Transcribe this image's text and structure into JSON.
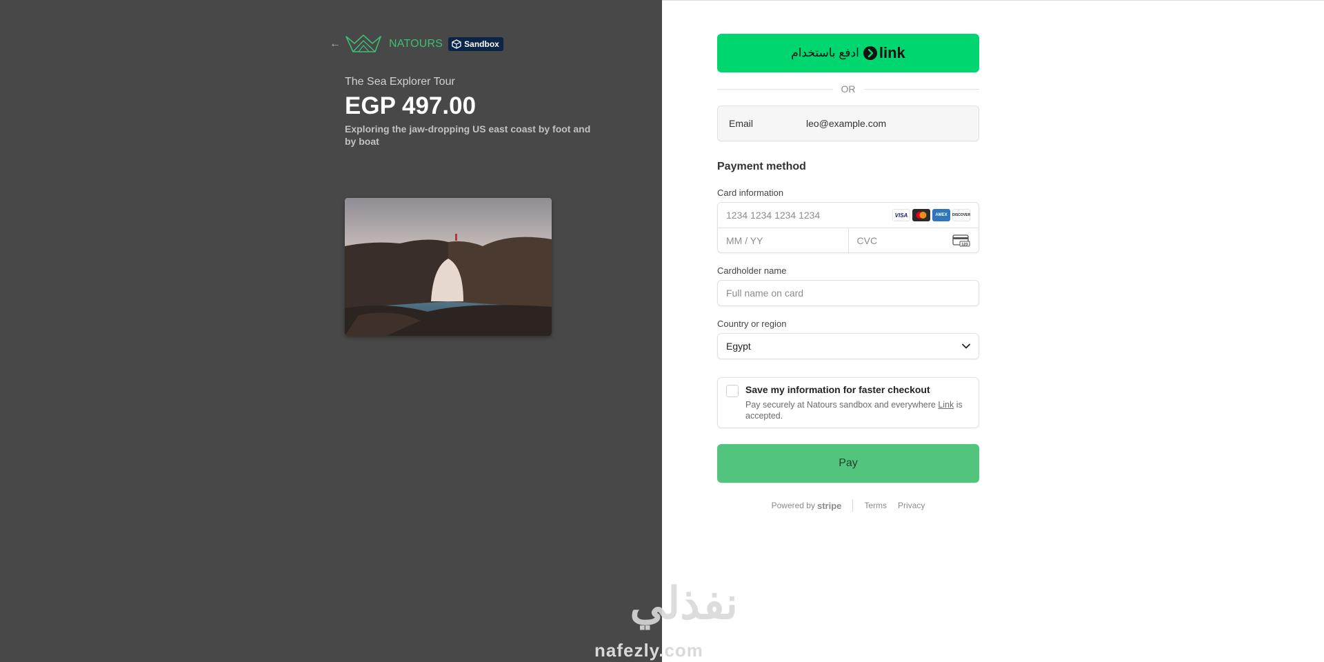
{
  "left": {
    "back_arrow": "←",
    "brand": "NATOURS",
    "sandbox_badge": "Sandbox",
    "tour_name": "The Sea Explorer Tour",
    "price": "EGP 497.00",
    "description": "Exploring the jaw-dropping US east coast by foot and by boat"
  },
  "link_button": {
    "text": "ادفع باستخدام",
    "logo_word": "link"
  },
  "or_divider": "OR",
  "email": {
    "label": "Email",
    "value": "leo@example.com"
  },
  "payment_method": {
    "title": "Payment method",
    "card_label": "Card information",
    "card_number_placeholder": "1234 1234 1234 1234",
    "expiry_placeholder": "MM / YY",
    "cvc_placeholder": "CVC",
    "card_brands": [
      "VISA",
      "mastercard",
      "AMEX",
      "DISCOVER"
    ],
    "cardholder_label": "Cardholder name",
    "cardholder_placeholder": "Full name on card",
    "country_label": "Country or region",
    "country_value": "Egypt"
  },
  "save_info": {
    "checked": false,
    "title": "Save my information for faster checkout",
    "sub_before": "Pay securely at Natours sandbox and everywhere ",
    "sub_link": "Link",
    "sub_after": " is accepted."
  },
  "pay_button": "Pay",
  "footer": {
    "powered_by": "Powered by",
    "stripe": "stripe",
    "terms": "Terms",
    "privacy": "Privacy"
  },
  "watermark": {
    "arabic": "نفذلي",
    "latin": "nafezly.com"
  },
  "colors": {
    "left_bg": "#484848",
    "brand_green": "#3fbf74",
    "link_green": "#00d66f",
    "pay_green": "#52c47e"
  }
}
